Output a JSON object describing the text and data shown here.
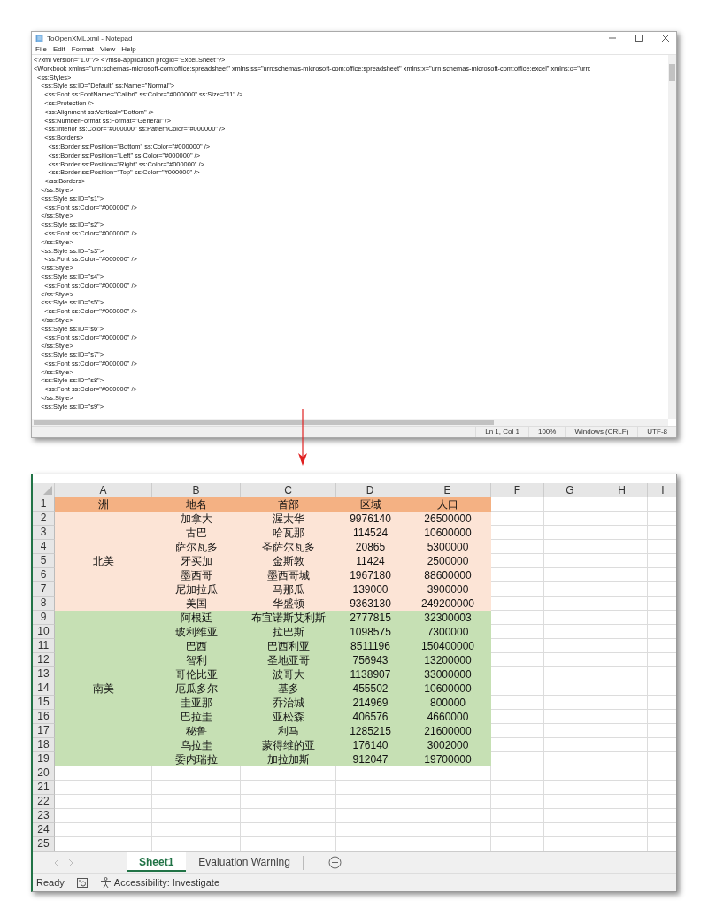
{
  "notepad": {
    "title": "ToOpenXML.xml - Notepad",
    "menu": [
      "File",
      "Edit",
      "Format",
      "View",
      "Help"
    ],
    "lines": [
      "<?xml version=\"1.0\"?> <?mso-application progid=\"Excel.Sheet\"?>",
      "<Workbook xmlns=\"urn:schemas-microsoft-com:office:spreadsheet\" xmlns:ss=\"urn:schemas-microsoft-com:office:spreadsheet\" xmlns:x=\"urn:schemas-microsoft-com:office:excel\" xmlns:o=\"urn:",
      "  <ss:Styles>",
      "    <ss:Style ss:ID=\"Default\" ss:Name=\"Normal\">",
      "      <ss:Font ss:FontName=\"Calibri\" ss:Color=\"#000000\" ss:Size=\"11\" />",
      "      <ss:Protection />",
      "      <ss:Alignment ss:Vertical=\"Bottom\" />",
      "      <ss:NumberFormat ss:Format=\"General\" />",
      "      <ss:Interior ss:Color=\"#000000\" ss:PatternColor=\"#000000\" />",
      "      <ss:Borders>",
      "        <ss:Border ss:Position=\"Bottom\" ss:Color=\"#000000\" />",
      "        <ss:Border ss:Position=\"Left\" ss:Color=\"#000000\" />",
      "        <ss:Border ss:Position=\"Right\" ss:Color=\"#000000\" />",
      "        <ss:Border ss:Position=\"Top\" ss:Color=\"#000000\" />",
      "      </ss:Borders>",
      "    </ss:Style>",
      "    <ss:Style ss:ID=\"s1\">",
      "      <ss:Font ss:Color=\"#000000\" />",
      "    </ss:Style>",
      "    <ss:Style ss:ID=\"s2\">",
      "      <ss:Font ss:Color=\"#000000\" />",
      "    </ss:Style>",
      "    <ss:Style ss:ID=\"s3\">",
      "      <ss:Font ss:Color=\"#000000\" />",
      "    </ss:Style>",
      "    <ss:Style ss:ID=\"s4\">",
      "      <ss:Font ss:Color=\"#000000\" />",
      "    </ss:Style>",
      "    <ss:Style ss:ID=\"s5\">",
      "      <ss:Font ss:Color=\"#000000\" />",
      "    </ss:Style>",
      "    <ss:Style ss:ID=\"s6\">",
      "      <ss:Font ss:Color=\"#000000\" />",
      "    </ss:Style>",
      "    <ss:Style ss:ID=\"s7\">",
      "      <ss:Font ss:Color=\"#000000\" />",
      "    </ss:Style>",
      "    <ss:Style ss:ID=\"s8\">",
      "      <ss:Font ss:Color=\"#000000\" />",
      "    </ss:Style>",
      "    <ss:Style ss:ID=\"s9\">"
    ],
    "status": [
      "Ln 1, Col 1",
      "100%",
      "Windows (CRLF)",
      "UTF-8"
    ]
  },
  "excel": {
    "columns": [
      "A",
      "B",
      "C",
      "D",
      "E",
      "F",
      "G",
      "H",
      "I"
    ],
    "row_numbers": [
      "1",
      "2",
      "3",
      "4",
      "5",
      "6",
      "7",
      "8",
      "9",
      "10",
      "11",
      "12",
      "13",
      "14",
      "15",
      "16",
      "17",
      "18",
      "19",
      "20",
      "21",
      "22",
      "23",
      "24",
      "25"
    ],
    "header": [
      "洲",
      "地名",
      "首部",
      "区域",
      "人口"
    ],
    "groups": [
      {
        "name": "北美",
        "color": "#fce4d6",
        "rows": [
          [
            "加拿大",
            "渥太华",
            "9976140",
            "26500000"
          ],
          [
            "古巴",
            "哈瓦那",
            "114524",
            "10600000"
          ],
          [
            "萨尔瓦多",
            "圣萨尔瓦多",
            "20865",
            "5300000"
          ],
          [
            "牙买加",
            "金斯敦",
            "11424",
            "2500000"
          ],
          [
            "墨西哥",
            "墨西哥城",
            "1967180",
            "88600000"
          ],
          [
            "尼加拉瓜",
            "马那瓜",
            "139000",
            "3900000"
          ],
          [
            "美国",
            "华盛顿",
            "9363130",
            "249200000"
          ]
        ]
      },
      {
        "name": "南美",
        "color": "#c6e0b4",
        "rows": [
          [
            "阿根廷",
            "布宜诺斯艾利斯",
            "2777815",
            "32300003"
          ],
          [
            "玻利维亚",
            "拉巴斯",
            "1098575",
            "7300000"
          ],
          [
            "巴西",
            "巴西利亚",
            "8511196",
            "150400000"
          ],
          [
            "智利",
            "圣地亚哥",
            "756943",
            "13200000"
          ],
          [
            "哥伦比亚",
            "波哥大",
            "1138907",
            "33000000"
          ],
          [
            "厄瓜多尔",
            "基多",
            "455502",
            "10600000"
          ],
          [
            "圭亚那",
            "乔治城",
            "214969",
            "800000"
          ],
          [
            "巴拉圭",
            "亚松森",
            "406576",
            "4660000"
          ],
          [
            "秘鲁",
            "利马",
            "1285215",
            "21600000"
          ],
          [
            "乌拉圭",
            "蒙得维的亚",
            "176140",
            "3002000"
          ],
          [
            "委内瑞拉",
            "加拉加斯",
            "912047",
            "19700000"
          ]
        ]
      }
    ],
    "sheet_tabs": [
      {
        "label": "Sheet1",
        "selected": true
      },
      {
        "label": "Evaluation Warning",
        "selected": false
      }
    ],
    "status": {
      "ready": "Ready",
      "accessibility": "Accessibility: Investigate"
    }
  }
}
